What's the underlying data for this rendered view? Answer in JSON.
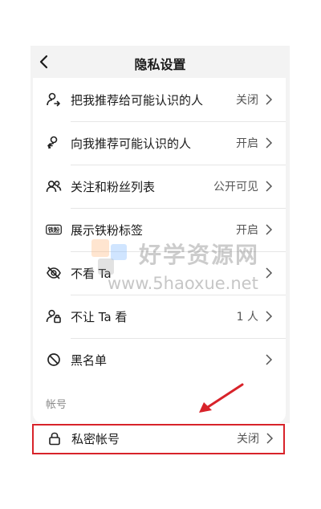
{
  "header": {
    "title": "隐私设置",
    "back_icon": "chevron-left-icon"
  },
  "rows": [
    {
      "label": "把我推荐给可能认识的人",
      "value": "关闭",
      "icon": "person-share-icon"
    },
    {
      "label": "向我推荐可能认识的人",
      "value": "开启",
      "icon": "person-recommend-icon"
    },
    {
      "label": "关注和粉丝列表",
      "value": "公开可见",
      "icon": "people-icon"
    },
    {
      "label": "展示铁粉标签",
      "value": "开启",
      "icon": "tiefen-badge-icon",
      "icon_text": "铁粉"
    },
    {
      "label": "不看 Ta",
      "value": "",
      "icon": "eye-off-icon"
    },
    {
      "label": "不让 Ta 看",
      "value": "1 人",
      "icon": "person-lock-icon"
    },
    {
      "label": "黑名单",
      "value": "",
      "icon": "block-icon"
    }
  ],
  "account_section": {
    "title": "帐号",
    "row": {
      "label": "私密帐号",
      "value": "关闭",
      "icon": "lock-icon"
    }
  },
  "watermark": {
    "cn": "好学资源网",
    "en": "www.5haoxue.net"
  },
  "colors": {
    "highlight": "#d8232a",
    "background": "#f3f3f3",
    "card": "#ffffff"
  }
}
